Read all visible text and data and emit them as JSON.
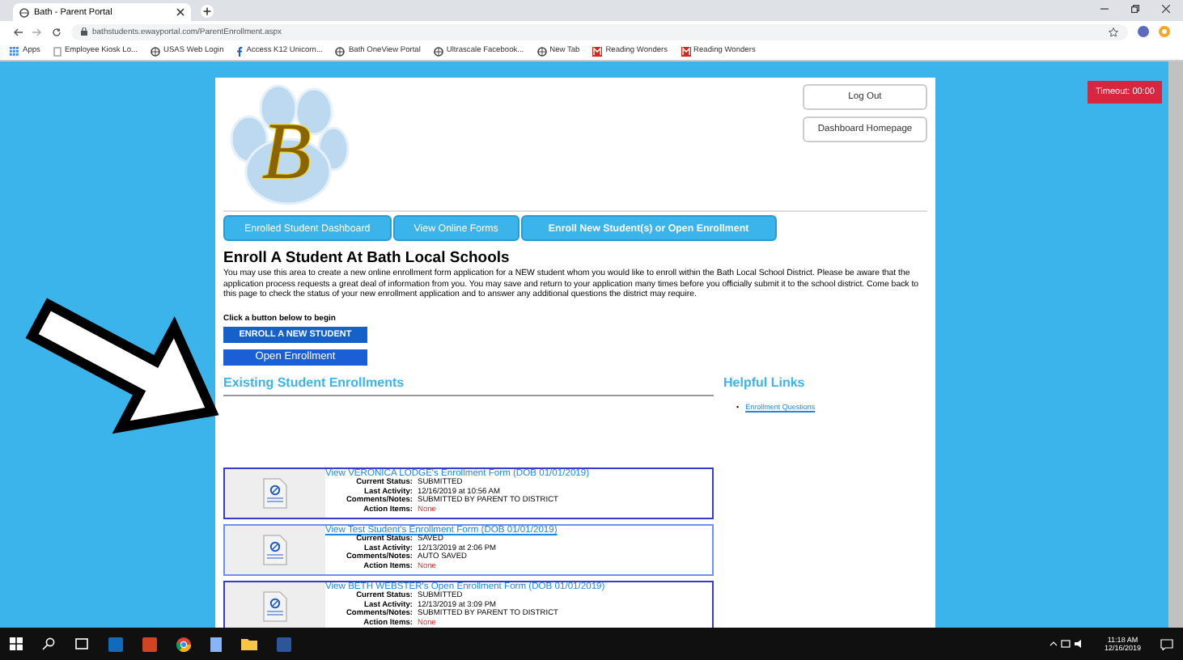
{
  "browser": {
    "tab_title": "Bath - Parent Portal",
    "url": "bathstudents.ewayportal.com/ParentEnrollment.aspx",
    "bookmarks": [
      {
        "label": "Apps",
        "kind": "apps"
      },
      {
        "label": "Employee Kiosk Lo...",
        "kind": "page"
      },
      {
        "label": "USAS Web Login",
        "kind": "globe"
      },
      {
        "label": "Access K12 Unicorn...",
        "kind": "facebook"
      },
      {
        "label": "Bath OneView Portal",
        "kind": "globe"
      },
      {
        "label": "Ultrascale Facebook...",
        "kind": "globe"
      },
      {
        "label": "New Tab",
        "kind": "globe"
      },
      {
        "label": "Reading Wonders",
        "kind": "square"
      },
      {
        "label": "Reading Wonders",
        "kind": "square"
      }
    ]
  },
  "logo_letter": "B",
  "header_buttons": [
    "Log Out",
    "Dashboard Homepage"
  ],
  "timeout": "Timeout: 00:00",
  "nav_tabs": [
    {
      "label": "Enrolled Student Dashboard",
      "selected": false
    },
    {
      "label": "View Online Forms",
      "selected": false
    },
    {
      "label": "Enroll New Student(s) or Open Enrollment",
      "selected": true
    }
  ],
  "intro": {
    "heading": "Enroll A Student At Bath Local Schools",
    "text": "You may use this area to create a new online enrollment form application for a NEW student whom you would like to enroll within the Bath Local School District. Please be aware that the application process requests a great deal of information from you. You may save and return to your application many times before you officially submit it to the school district. Come back to this page to check the status of your new enrollment application and to answer any additional questions the district may require.",
    "prompt": "Click a button below to begin",
    "buttons": [
      {
        "label": "ENROLL A NEW STUDENT",
        "kind": "primary"
      },
      {
        "label": "Open Enrollment",
        "kind": "secondary"
      }
    ]
  },
  "enrollments": {
    "title": "Existing Student Enrollments",
    "items": [
      {
        "link": "View VERONICA LODGE's Enrollment Form (DOB 01/01/2019)",
        "highlighted": false,
        "fields": [
          {
            "label": "Current Status:",
            "value": "SUBMITTED",
            "kind": "plain"
          },
          {
            "label": "Last Activity:",
            "value": "12/16/2019 at 10:56 AM",
            "kind": "plain"
          },
          {
            "label": "Comments/Notes:",
            "value": "SUBMITTED BY PARENT TO DISTRICT",
            "kind": "plain"
          },
          {
            "label": "Action Items:",
            "value": "None",
            "kind": "alert"
          }
        ]
      },
      {
        "link": "View Test Student's Enrollment Form (DOB 01/01/2019)",
        "highlighted": true,
        "fields": [
          {
            "label": "Current Status:",
            "value": "SAVED",
            "kind": "plain"
          },
          {
            "label": "Last Activity:",
            "value": "12/13/2019 at 2:06 PM",
            "kind": "plain"
          },
          {
            "label": "Comments/Notes:",
            "value": "AUTO SAVED",
            "kind": "plain"
          },
          {
            "label": "Action Items:",
            "value": "None",
            "kind": "alert"
          }
        ]
      },
      {
        "link": "View BETH WEBSTER's Open Enrollment Form (DOB 01/01/2019)",
        "highlighted": false,
        "fields": [
          {
            "label": "Current Status:",
            "value": "SUBMITTED",
            "kind": "plain"
          },
          {
            "label": "Last Activity:",
            "value": "12/13/2019 at 3:09 PM",
            "kind": "plain"
          },
          {
            "label": "Comments/Notes:",
            "value": "SUBMITTED BY PARENT TO DISTRICT",
            "kind": "plain"
          },
          {
            "label": "Action Items:",
            "value": "None",
            "kind": "alert"
          }
        ]
      }
    ]
  },
  "helpful_links": {
    "title": "Helpful Links",
    "bullet": "•",
    "links": [
      "Enrollment Questions"
    ]
  },
  "taskbar": {
    "time": "11:18 AM",
    "date": "12/16/2019"
  }
}
